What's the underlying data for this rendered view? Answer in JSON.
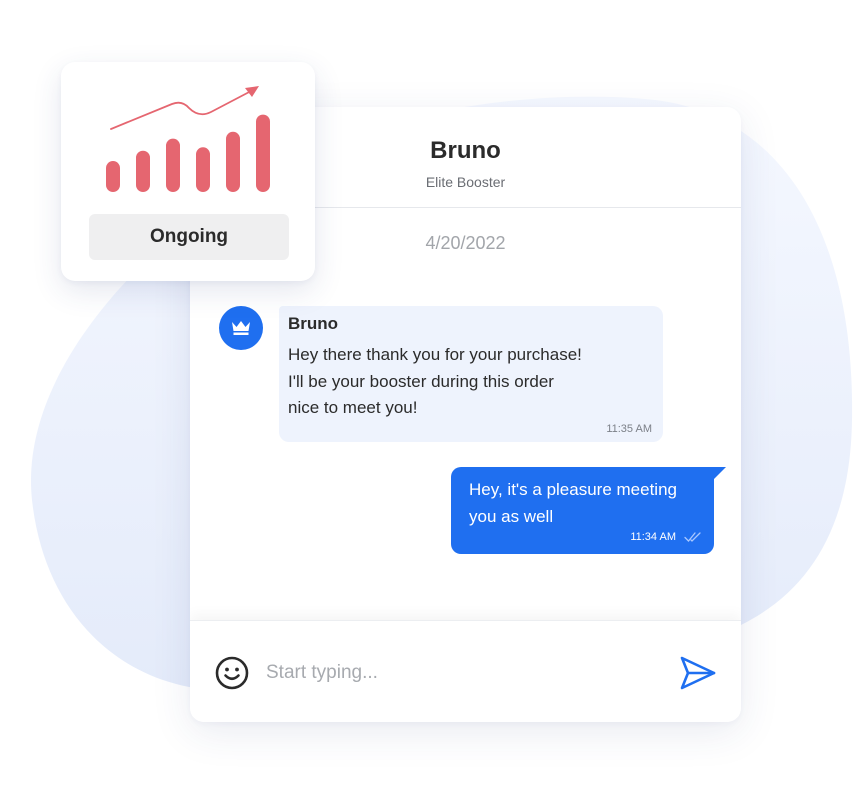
{
  "chat": {
    "contact_name": "Bruno",
    "contact_role": "Elite Booster",
    "date": "4/20/2022",
    "incoming": {
      "sender": "Bruno",
      "lines": [
        "Hey there thank you for your purchase!",
        "I'll be your booster during this order",
        "nice to meet you!"
      ],
      "time": "11:35 AM"
    },
    "outgoing": {
      "lines": [
        "Hey, it's a pleasure meeting",
        "you as well"
      ],
      "time": "11:34 AM"
    },
    "input": {
      "placeholder": "Start typing..."
    }
  },
  "status_card": {
    "label": "Ongoing",
    "bar_levels": [
      0.36,
      0.48,
      0.62,
      0.52,
      0.7,
      0.9
    ]
  },
  "icons": {
    "avatar": "crown-icon",
    "emoji": "smiley-icon",
    "send": "paper-plane-icon",
    "read_receipt": "double-check-icon",
    "trend": "trend-arrow-icon"
  },
  "colors": {
    "accent": "#1f6ff0",
    "bars": "#e56670",
    "incoming_bubble": "#eef3fd",
    "blob": "#e8eefb"
  }
}
